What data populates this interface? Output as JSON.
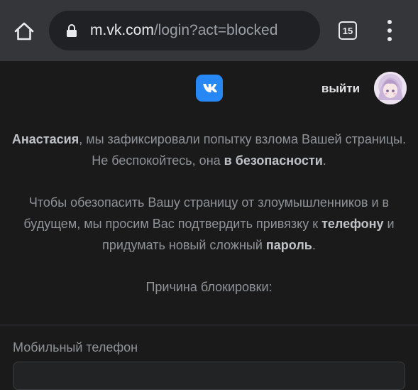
{
  "browser": {
    "url_host": "m.vk.com",
    "url_path": "/login?act=blocked",
    "tab_count": "15",
    "icons": {
      "home": "home-icon",
      "lock": "lock-icon",
      "menu": "more-vert-icon"
    }
  },
  "header": {
    "logo": "vk-logo",
    "logout_label": "выйти",
    "avatar": "avatar"
  },
  "message": {
    "p1_name": "Анастасия",
    "p1_text": ", мы зафиксировали попытку взлома Вашей страницы.",
    "p2_text": "Не беспокойтесь, она ",
    "p2_bold": "в безопасности",
    "p2_end": ".",
    "p3_text_a": "Чтобы обезопасить Вашу страницу от злоумышленников и в будущем, мы просим Вас подтвердить привязку к ",
    "p3_bold_phone": "телефону",
    "p3_text_b": " и придумать новый сложный ",
    "p3_bold_password": "пароль",
    "p3_end": ".",
    "reason_label": "Причина блокировки:"
  },
  "form": {
    "phone_label": "Мобильный телефон",
    "phone_value": ""
  },
  "colors": {
    "browser_bar": "#35363a",
    "omnibox": "#202124",
    "page_bg": "#1a1a1a",
    "vk_blue": "#2787f5",
    "text_muted": "#8f9398",
    "text_bold": "#bfc3c8"
  }
}
